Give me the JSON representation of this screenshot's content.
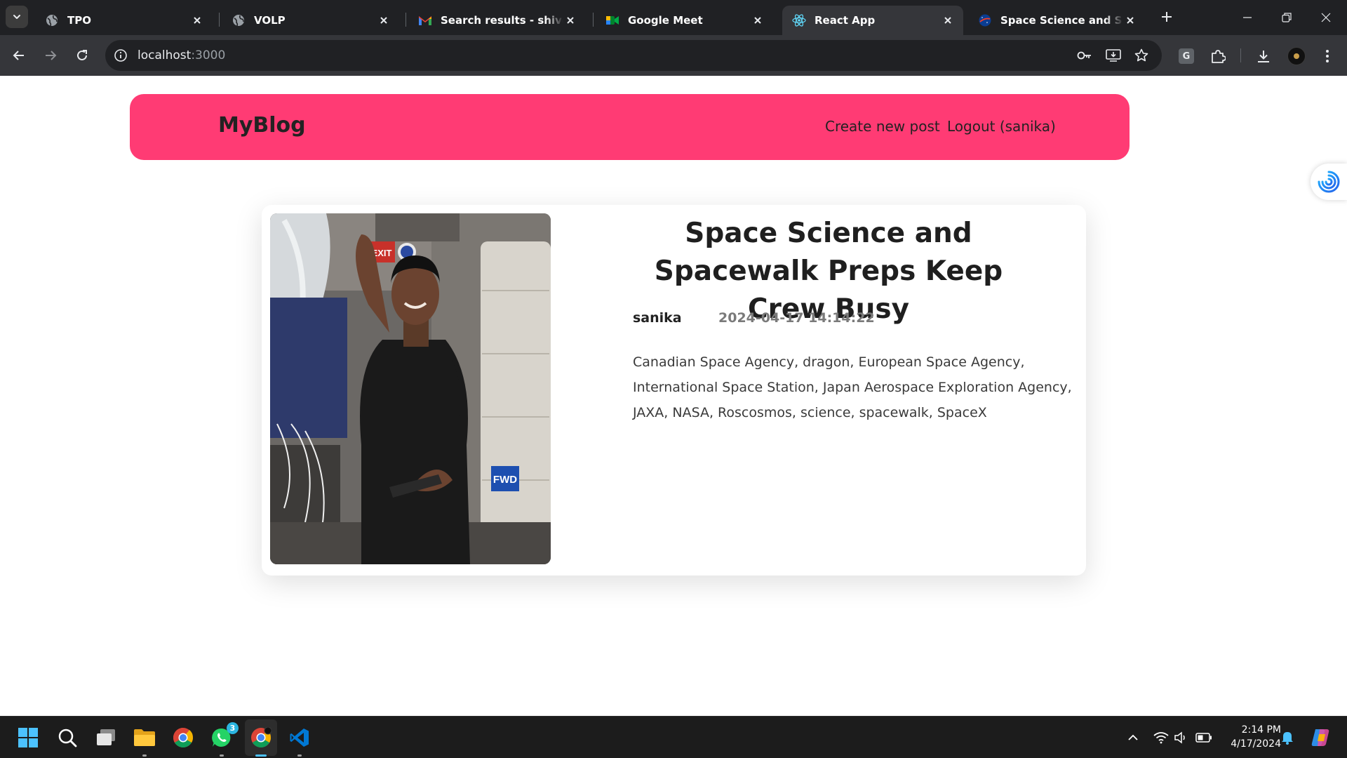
{
  "browser": {
    "tabs": [
      {
        "label": "TPO",
        "favicon": "globe-icon",
        "active": false
      },
      {
        "label": "VOLP",
        "favicon": "globe-icon",
        "active": false
      },
      {
        "label": "Search results - shivdas.na",
        "favicon": "gmail-icon",
        "active": false
      },
      {
        "label": "Google Meet",
        "favicon": "google-meet-icon",
        "active": false
      },
      {
        "label": "React App",
        "favicon": "react-icon",
        "active": true
      },
      {
        "label": "Space Science and Spacew",
        "favicon": "nasa-icon",
        "active": false
      }
    ],
    "url_host": "localhost",
    "url_port": ":3000",
    "extension_letter": "G"
  },
  "page": {
    "logo": "MyBlog",
    "nav_links": [
      "Create new post",
      "Logout (sanika)"
    ],
    "post": {
      "title": "Space Science and Spacewalk Preps Keep Crew Busy",
      "author": "sanika",
      "date": "2024-04-17 14:14:22",
      "summary": "Canadian Space Agency, dragon, European Space Agency, International Space Station, Japan Aerospace Exploration Agency, JAXA, NASA, Roscosmos, science, spacewalk, SpaceX",
      "image": {
        "label_top": "EXIT",
        "label_side": "FWD"
      }
    }
  },
  "taskbar": {
    "whatsapp_badge": "3",
    "time": "2:14 PM",
    "date": "4/17/2024"
  },
  "colors": {
    "navbar": "#ff3b74",
    "tabstrip": "#202124",
    "toolbar": "#35363a",
    "taskbar": "#1c1c1c"
  }
}
